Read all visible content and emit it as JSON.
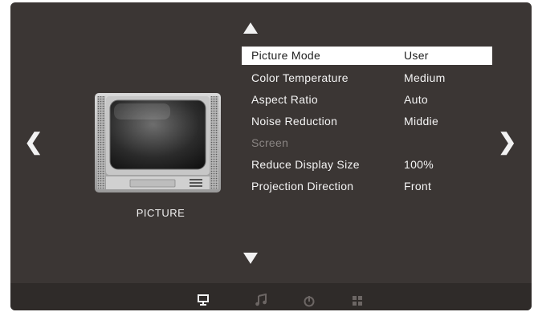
{
  "menu": {
    "items": [
      {
        "label": "Picture Mode",
        "value": "User"
      },
      {
        "label": "Color Temperature",
        "value": "Medium"
      },
      {
        "label": "Aspect Ratio",
        "value": "Auto"
      },
      {
        "label": "Noise Reduction",
        "value": "Middie"
      },
      {
        "label": "Screen",
        "value": ""
      },
      {
        "label": "Reduce Display Size",
        "value": "100%"
      },
      {
        "label": "Projection Direction",
        "value": "Front"
      }
    ]
  },
  "section": {
    "label": "PICTURE"
  },
  "nav": {
    "prev_icon": "chevron-left-icon",
    "next_icon": "chevron-right-icon",
    "up_icon": "triangle-up-icon",
    "down_icon": "triangle-down-icon"
  },
  "tabs": [
    {
      "icon": "monitor-icon",
      "active": true
    },
    {
      "icon": "music-note-icon",
      "active": false
    },
    {
      "icon": "power-clock-icon",
      "active": false
    },
    {
      "icon": "grid-icon",
      "active": false
    }
  ],
  "colors": {
    "background": "#3b3634",
    "text": "#f4f4f4",
    "disabled": "#8a8583",
    "highlight": "#ffffff"
  }
}
